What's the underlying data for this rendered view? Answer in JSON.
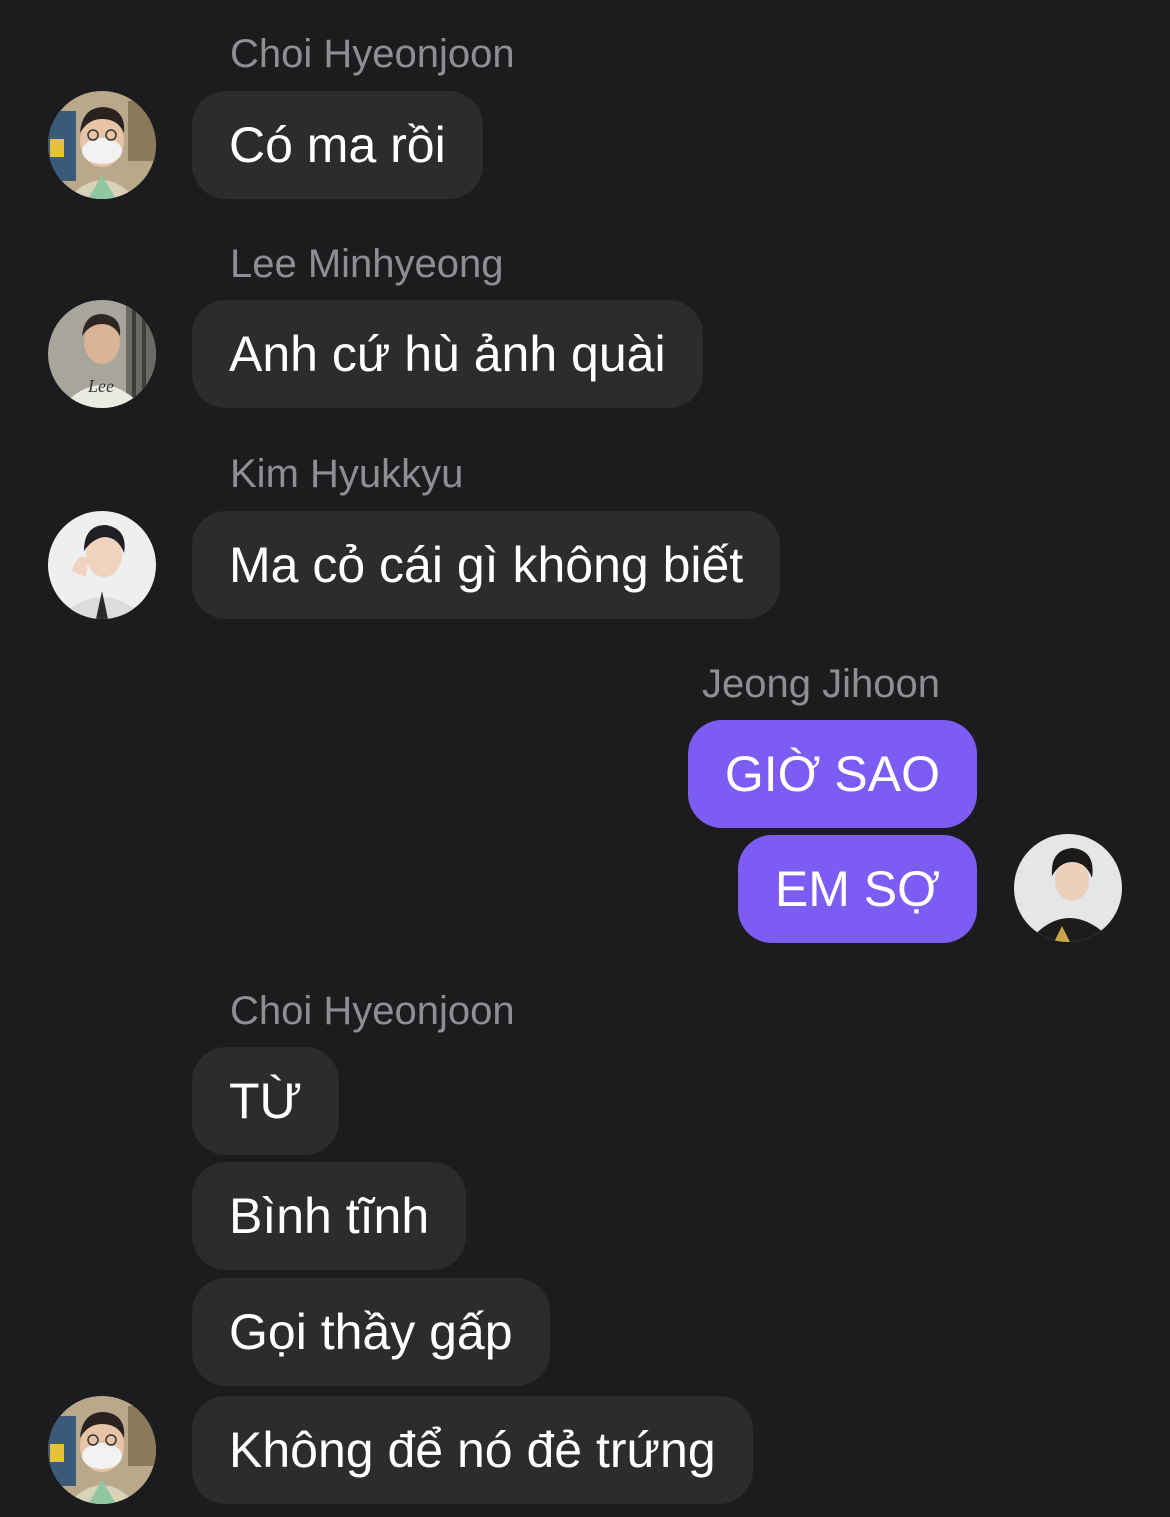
{
  "colors": {
    "background": "#1c1c1e",
    "incoming_bubble": "#2c2c2e",
    "outgoing_bubble": "#7c5cf2",
    "sender_name": "#8e8e93",
    "message_text": "#ffffff"
  },
  "messages": [
    {
      "sender": "Choi Hyeonjoon",
      "text": "Có ma rồi",
      "avatar": "avatar-choi-hyeonjoon"
    },
    {
      "sender": "Lee Minhyeong",
      "text": "Anh cứ hù ảnh quài",
      "avatar": "avatar-lee-minhyeong"
    },
    {
      "sender": "Kim Hyukkyu",
      "text": "Ma cỏ cái gì không biết",
      "avatar": "avatar-kim-hyukkyu"
    },
    {
      "sender": "Jeong Jihoon",
      "texts": [
        "GIỜ SAO",
        "EM SỢ"
      ],
      "avatar": "avatar-jeong-jihoon"
    },
    {
      "sender": "Choi Hyeonjoon",
      "texts": [
        "TỪ",
        "Bình tĩnh",
        "Gọi thầy gấp",
        "Không để nó đẻ trứng"
      ],
      "avatar": "avatar-choi-hyeonjoon"
    }
  ],
  "avatar_logo_text": "Lee"
}
